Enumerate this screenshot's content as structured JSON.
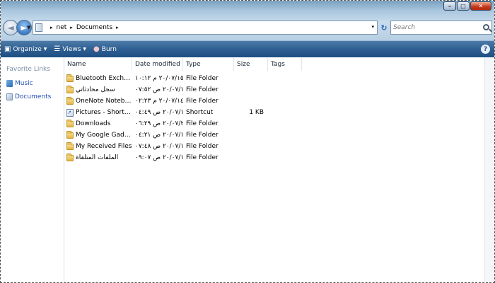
{
  "titlebar": {
    "minimize_label": "–",
    "maximize_label": "□",
    "close_label": "✕"
  },
  "nav": {
    "back_glyph": "◄",
    "forward_glyph": "►",
    "dropdown_glyph": "▼"
  },
  "address": {
    "breadcrumbs": [
      {
        "label": "net"
      },
      {
        "label": "Documents"
      }
    ],
    "separator": "▸",
    "dropdown_glyph": "▾",
    "refresh_glyph": "↻"
  },
  "search": {
    "placeholder": "Search",
    "icon": "search-icon"
  },
  "toolbar": {
    "organize_label": "Organize",
    "views_label": "Views",
    "burn_label": "Burn",
    "help_label": "?",
    "accent": "#2f5f92"
  },
  "navpane": {
    "title": "Favorite Links",
    "links": [
      {
        "label": "Music",
        "icon": "music-icon"
      },
      {
        "label": "Documents",
        "icon": "documents-icon"
      }
    ]
  },
  "columns": {
    "name": "Name",
    "date": "Date modified",
    "type": "Type",
    "size": "Size",
    "tags": "Tags"
  },
  "files": [
    {
      "name": "Bluetooth Exchange Fo...",
      "date": "٢٠/٠٧/١٥ م ١٠:١٢",
      "type": "File Folder",
      "size": "",
      "icon": "folder-icon"
    },
    {
      "name": "سجل محادثاتي",
      "date": "٢٠/٠٧/١٥ ص ٠٧:٥٢",
      "type": "File Folder",
      "size": "",
      "icon": "folder-icon"
    },
    {
      "name": "OneNote Notebooks",
      "date": "٢٠/٠٧/١٤ م ٠٢:٢٣",
      "type": "File Folder",
      "size": "",
      "icon": "folder-icon"
    },
    {
      "name": "Pictures - Shortcut",
      "date": "٢٠/٠٧/١٠ ص ٠٤:٤٩",
      "type": "Shortcut",
      "size": "1 KB",
      "icon": "shortcut-icon"
    },
    {
      "name": "Downloads",
      "date": "٢٠/٠٧/٢٦ ص ٠٦:٢٩",
      "type": "File Folder",
      "size": "",
      "icon": "folder-icon"
    },
    {
      "name": "My Google Gadgets",
      "date": "٢٠/٠٧/١٥ ص ٠٤:٢١",
      "type": "File Folder",
      "size": "",
      "icon": "folder-icon"
    },
    {
      "name": "My Received Files",
      "date": "٢٠/٠٧/١٥ ص ٠٧:٤٨",
      "type": "File Folder",
      "size": "",
      "icon": "folder-icon"
    },
    {
      "name": "الملفات المتلقاة",
      "date": "٢٠/٠٧/١٤ ص ٠٩:٠٧",
      "type": "File Folder",
      "size": "",
      "icon": "folder-icon"
    }
  ]
}
